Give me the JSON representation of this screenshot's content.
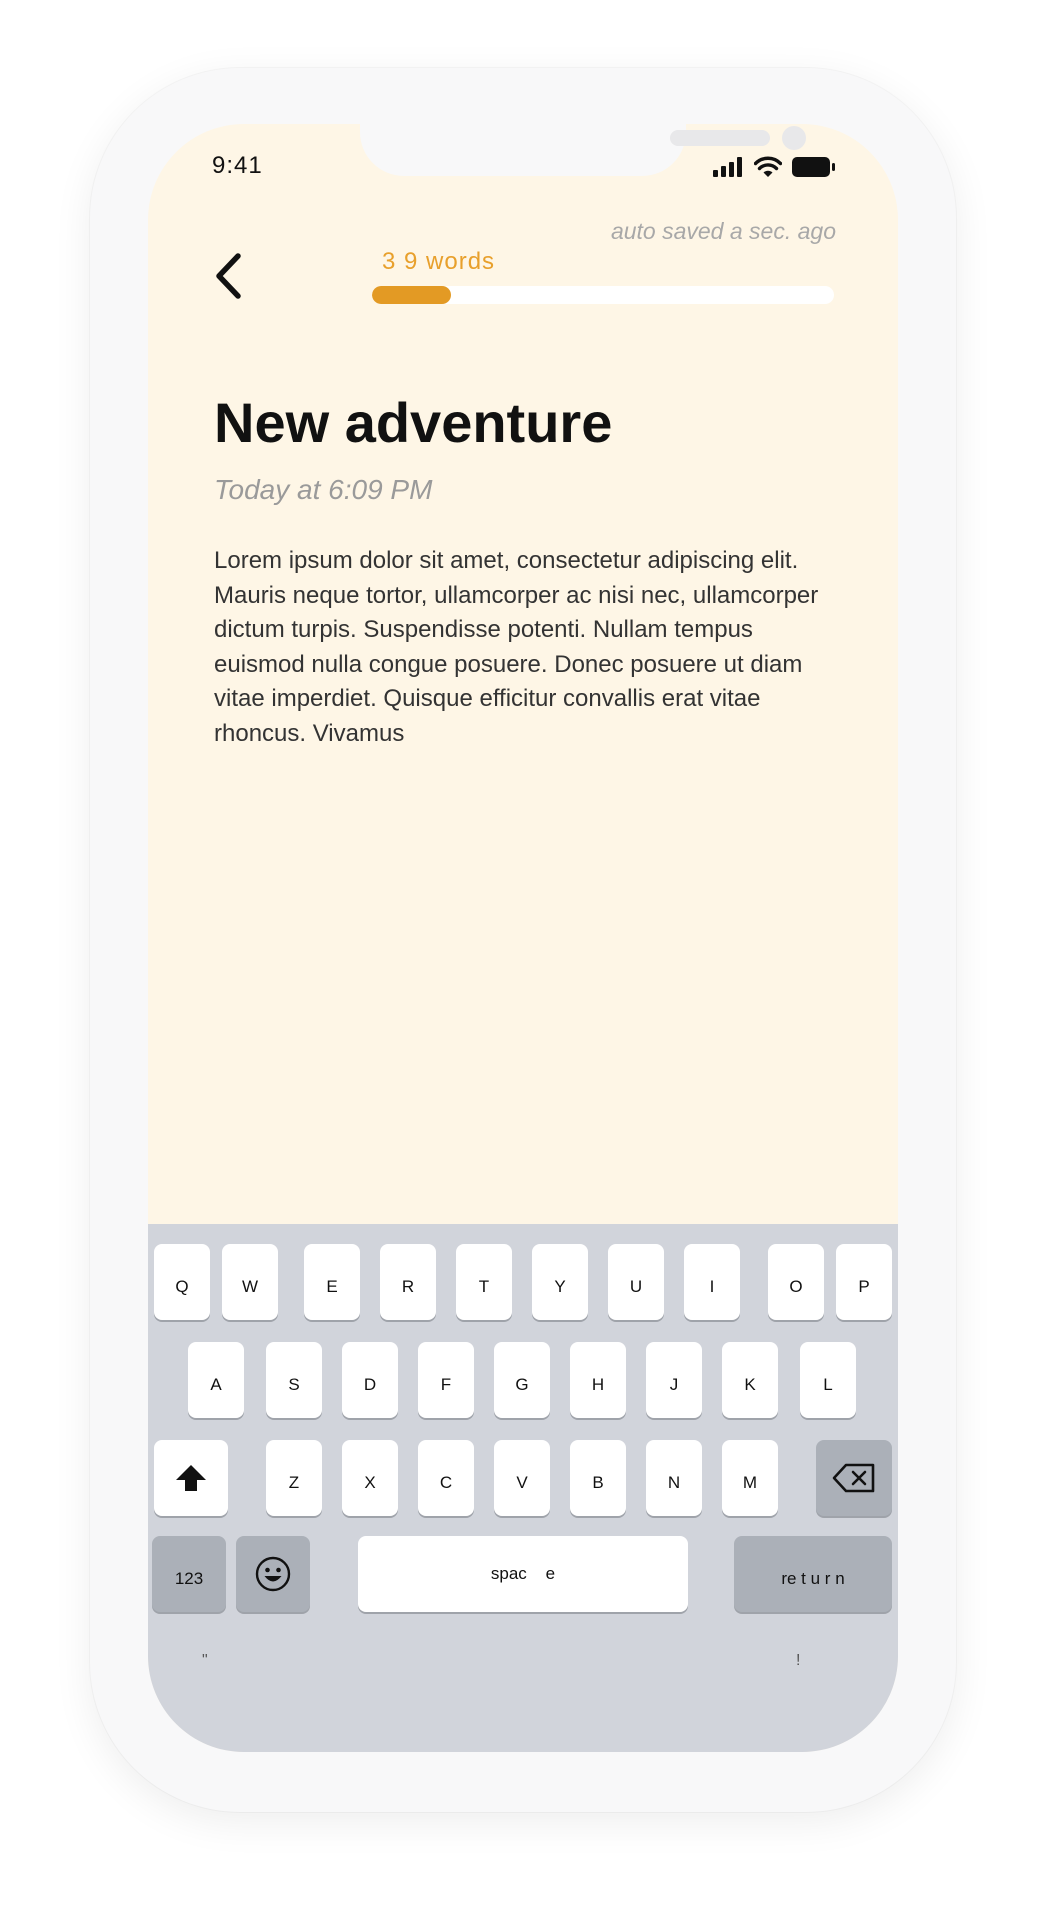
{
  "status_bar": {
    "time": "9:41",
    "signal_icon": "cellular-signal-icon",
    "wifi_icon": "wifi-icon",
    "battery_icon": "battery-icon"
  },
  "header": {
    "back_icon": "chevron-left-icon",
    "word_count": "3 9  words",
    "auto_saved": "auto saved a sec. ago",
    "progress_fraction": 0.17,
    "accent_color": "#e39a24"
  },
  "note": {
    "title": "New adventure",
    "date": "Today at 6:09 PM",
    "body": "Lorem ipsum dolor sit amet, consectetur adipiscing elit. Mauris neque tortor, ullamcorper ac nisi nec, ullamcorper dictum turpis. Suspendisse potenti. Nullam tempus euismod nulla congue posuere. Donec posuere ut diam vitae imperdiet. Quisque efficitur convallis erat vitae rhoncus. Vivamus"
  },
  "keyboard": {
    "row1": [
      "Q",
      "W",
      "E",
      "R",
      "T",
      "Y",
      "U",
      "I",
      "O",
      "P"
    ],
    "row2": [
      "A",
      "S",
      "D",
      "F",
      "G",
      "H",
      "J",
      "K",
      "L"
    ],
    "row3": [
      "Z",
      "X",
      "C",
      "V",
      "B",
      "N",
      "M"
    ],
    "shift_icon": "shift-arrow-icon",
    "delete_icon": "backspace-icon",
    "numbers_label": "123",
    "emoji_icon": "emoji-smiley-icon",
    "space_label": "spac    e",
    "return_label": "re t u r n",
    "hint_left": "\"",
    "hint_right": "!"
  },
  "colors": {
    "screen_background": "#fef6e6",
    "keyboard_background": "#d1d4db"
  }
}
